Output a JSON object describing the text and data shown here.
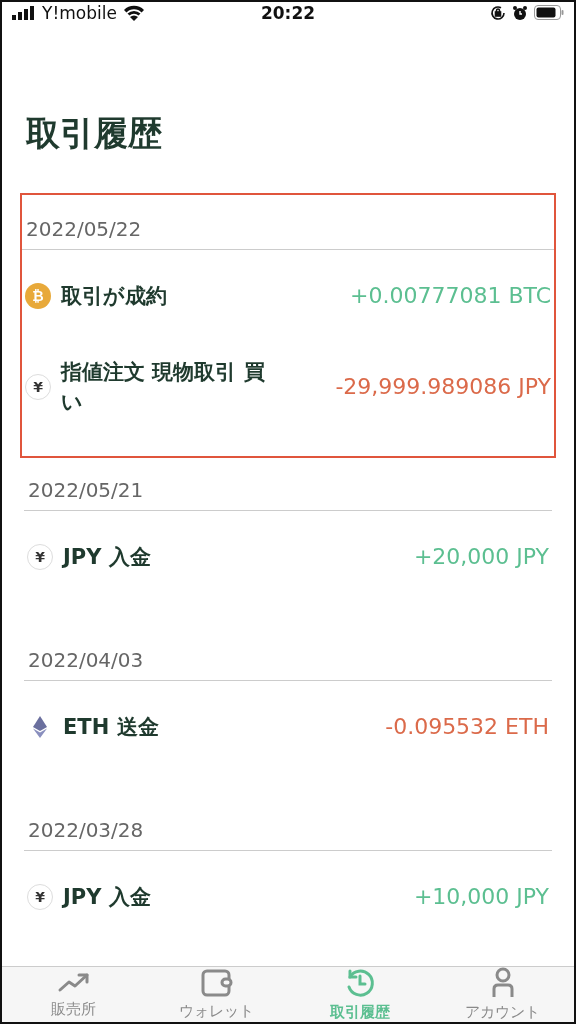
{
  "status_bar": {
    "carrier": "Y!mobile",
    "time": "20:22"
  },
  "title": "取引履歴",
  "groups": [
    {
      "date": "2022/05/22",
      "highlighted": true,
      "rows": [
        {
          "coin": {
            "kind": "btc",
            "symbol": "₿"
          },
          "label": "取引が成約",
          "amount": "+0.00777081 BTC",
          "kind": "credit"
        },
        {
          "coin": {
            "kind": "jpy",
            "symbol": "¥"
          },
          "label": "指値注文 現物取引 買い",
          "amount": "-29,999.989086 JPY",
          "kind": "debit"
        }
      ]
    },
    {
      "date": "2022/05/21",
      "highlighted": false,
      "rows": [
        {
          "coin": {
            "kind": "jpy",
            "symbol": "¥"
          },
          "label": "JPY 入金",
          "amount": "+20,000 JPY",
          "kind": "credit"
        }
      ]
    },
    {
      "date": "2022/04/03",
      "highlighted": false,
      "rows": [
        {
          "coin": {
            "kind": "eth"
          },
          "label": "ETH 送金",
          "amount": "-0.095532 ETH",
          "kind": "debit"
        }
      ]
    },
    {
      "date": "2022/03/28",
      "highlighted": false,
      "rows": [
        {
          "coin": {
            "kind": "jpy",
            "symbol": "¥"
          },
          "label": "JPY 入金",
          "amount": "+10,000 JPY",
          "kind": "credit"
        }
      ]
    }
  ],
  "tabs": [
    {
      "kind": "market",
      "label": "販売所",
      "selected": false
    },
    {
      "kind": "wallet",
      "label": "ウォレット",
      "selected": false
    },
    {
      "kind": "history",
      "label": "取引履歴",
      "selected": true
    },
    {
      "kind": "account",
      "label": "アカウント",
      "selected": false
    }
  ]
}
